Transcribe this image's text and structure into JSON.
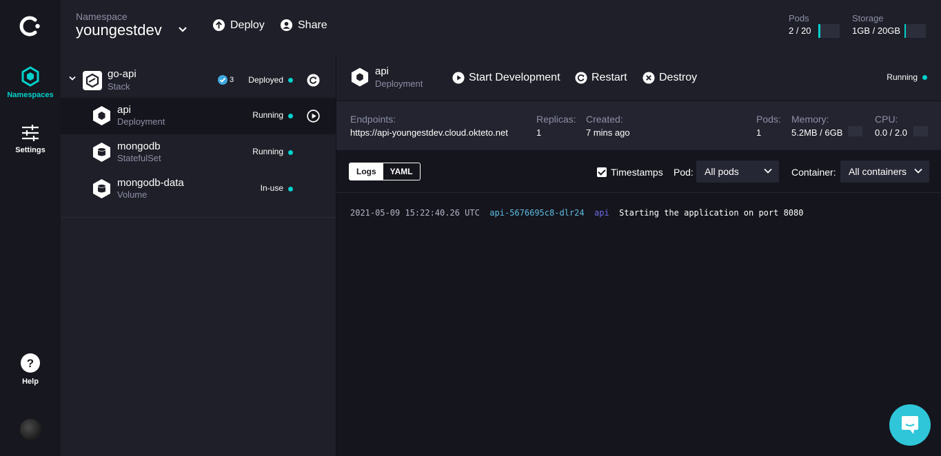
{
  "rail": {
    "namespaces_label": "Namespaces",
    "settings_label": "Settings",
    "help_label": "Help"
  },
  "header": {
    "namespace_caption": "Namespace",
    "namespace_name": "youngestdev",
    "deploy_label": "Deploy",
    "share_label": "Share",
    "pods": {
      "label": "Pods",
      "value": "2 / 20",
      "fraction": 0.1
    },
    "storage": {
      "label": "Storage",
      "value": "1GB / 20GB",
      "fraction": 0.05
    }
  },
  "list": {
    "stack": {
      "name": "go-api",
      "type": "Stack",
      "check_count": "3",
      "status": "Deployed"
    },
    "items": [
      {
        "name": "api",
        "type": "Deployment",
        "status": "Running"
      },
      {
        "name": "mongodb",
        "type": "StatefulSet",
        "status": "Running"
      },
      {
        "name": "mongodb-data",
        "type": "Volume",
        "status": "In-use"
      }
    ]
  },
  "detail": {
    "name": "api",
    "type": "Deployment",
    "start_label": "Start Development",
    "restart_label": "Restart",
    "destroy_label": "Destroy",
    "status": "Running"
  },
  "metrics": {
    "endpoints": {
      "label": "Endpoints:",
      "value": "https://api-youngestdev.cloud.okteto.net"
    },
    "replicas": {
      "label": "Replicas:",
      "value": "1"
    },
    "created": {
      "label": "Created:",
      "value": "7 mins ago"
    },
    "pods": {
      "label": "Pods:",
      "value": "1"
    },
    "memory": {
      "label": "Memory:",
      "value": "5.2MB / 6GB"
    },
    "cpu": {
      "label": "CPU:",
      "value": "0.0 / 2.0"
    }
  },
  "logs": {
    "tab_logs": "Logs",
    "tab_yaml": "YAML",
    "timestamps_label": "Timestamps",
    "timestamps_checked": true,
    "pod_label": "Pod:",
    "pod_value": "All pods",
    "container_label": "Container:",
    "container_value": "All containers",
    "lines": [
      {
        "timestamp": "2021-05-09 15:22:40.26 UTC",
        "pod": "api-5676695c8-dlr24",
        "container": "api",
        "message": "Starting the application on port 8080"
      }
    ]
  },
  "colors": {
    "accent": "#00d1ca",
    "rail_bg": "#17181f",
    "panel_bg": "#1e1f29",
    "log_bg": "#15161d",
    "chat": "#2fc6d9"
  }
}
